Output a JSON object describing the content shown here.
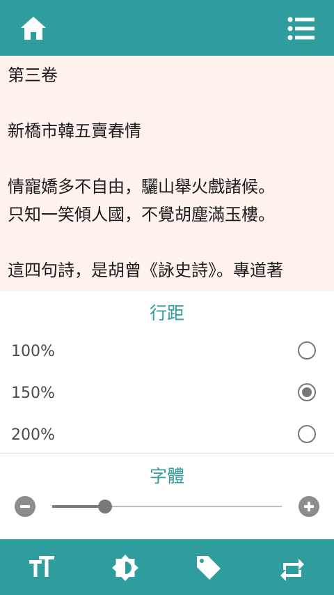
{
  "colors": {
    "accent": "#2f9d9d",
    "reader_bg": "#fff1ec"
  },
  "topbar": {
    "home_icon": "home-icon",
    "menu_icon": "list-menu-icon"
  },
  "reader": {
    "text": "第三卷\n\n新橋市韓五賣春情\n\n情寵嬌多不自由，驪山舉火戲諸候。\n只知一笑傾人國，不覺胡塵滿玉樓。\n\n這四句詩，是胡曾《詠史詩》。專道著"
  },
  "settings": {
    "line_spacing": {
      "title": "行距",
      "options": [
        {
          "label": "100%",
          "selected": false
        },
        {
          "label": "150%",
          "selected": true
        },
        {
          "label": "200%",
          "selected": false
        }
      ]
    },
    "font": {
      "title": "字體",
      "size_level": 0.23
    }
  },
  "bottombar": {
    "icons": [
      "font-size-icon",
      "brightness-icon",
      "tag-icon",
      "repeat-icon"
    ]
  }
}
